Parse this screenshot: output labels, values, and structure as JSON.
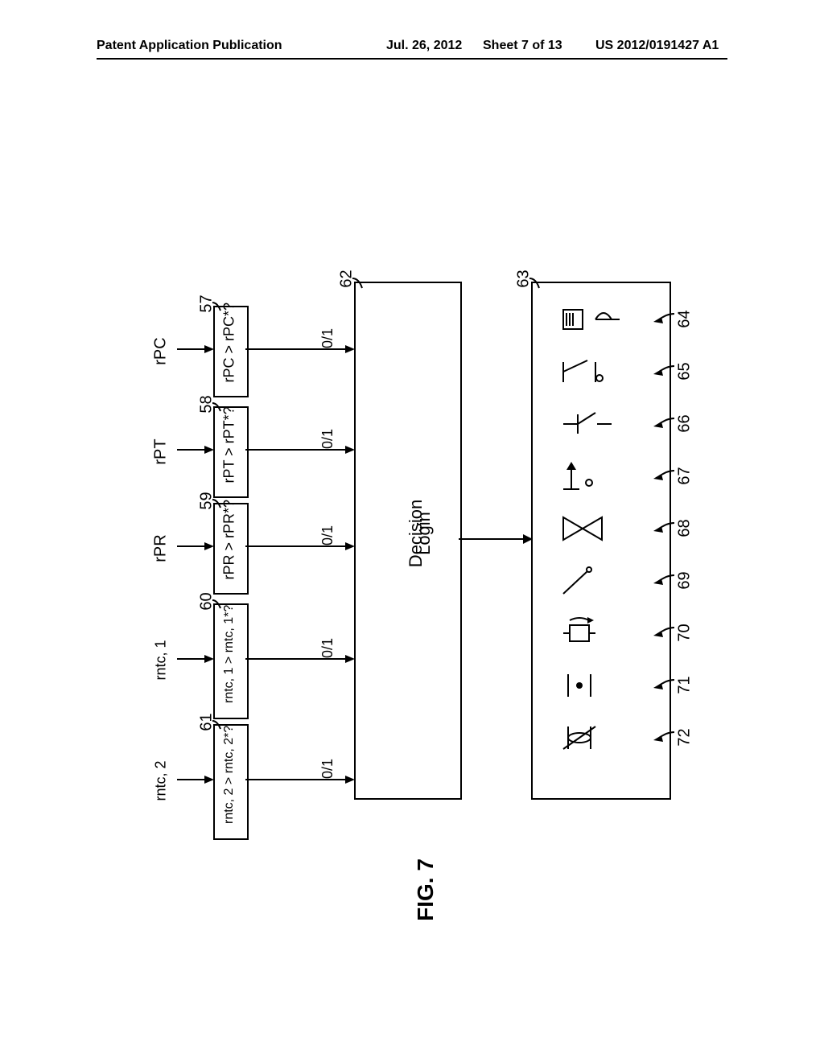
{
  "header": {
    "left": "Patent Application Publication",
    "center": "Jul. 26, 2012",
    "sheet": "Sheet 7 of 13",
    "right": "US 2012/0191427 A1"
  },
  "figure_label": "FIG. 7",
  "refs": {
    "q1": "57",
    "q2": "58",
    "q3": "59",
    "q4": "60",
    "q5": "61",
    "decision": "62",
    "outputs_box": "63",
    "o1": "64",
    "o2": "65",
    "o3": "66",
    "o4": "67",
    "o5": "68",
    "o6": "69",
    "o7": "70",
    "o8": "71",
    "o9": "72"
  },
  "inputs": {
    "i1": "rPC",
    "i2": "rPT",
    "i3": "rPR",
    "i4": "rntc, 1",
    "i5": "rntc, 2"
  },
  "conditions": {
    "c1": "rPC > rPC*?",
    "c2": "rPT > rPT*?",
    "c3": "rPR > rPR*?",
    "c4": "rntc, 1 > rntc, 1*?",
    "c5": "rntc, 2 > rntc, 2*?"
  },
  "edge_label": "0/1",
  "decision_line1": "Decision",
  "decision_line2": "Login"
}
